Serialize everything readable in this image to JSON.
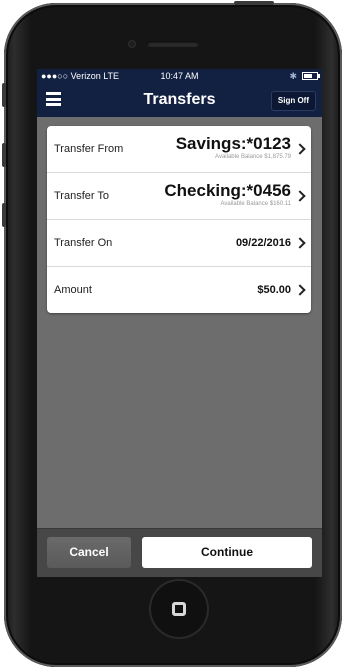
{
  "status_bar": {
    "carrier": "●●●○○ Verizon  LTE",
    "time": "10:47 AM",
    "bluetooth_icon": "bluetooth-icon",
    "battery_icon": "battery-icon"
  },
  "nav": {
    "title": "Transfers",
    "sign_off_label": "Sign Off",
    "menu_icon": "hamburger-menu-icon"
  },
  "transfer_form": {
    "rows": [
      {
        "label": "Transfer From",
        "account": "Savings:*0123",
        "balance": "Available Balance  $1,875.79"
      },
      {
        "label": "Transfer To",
        "account": "Checking:*0456",
        "balance": "Available Balance  $160.11"
      },
      {
        "label": "Transfer On",
        "value": "09/22/2016"
      },
      {
        "label": "Amount",
        "value": "$50.00"
      }
    ]
  },
  "footer": {
    "cancel_label": "Cancel",
    "continue_label": "Continue"
  }
}
